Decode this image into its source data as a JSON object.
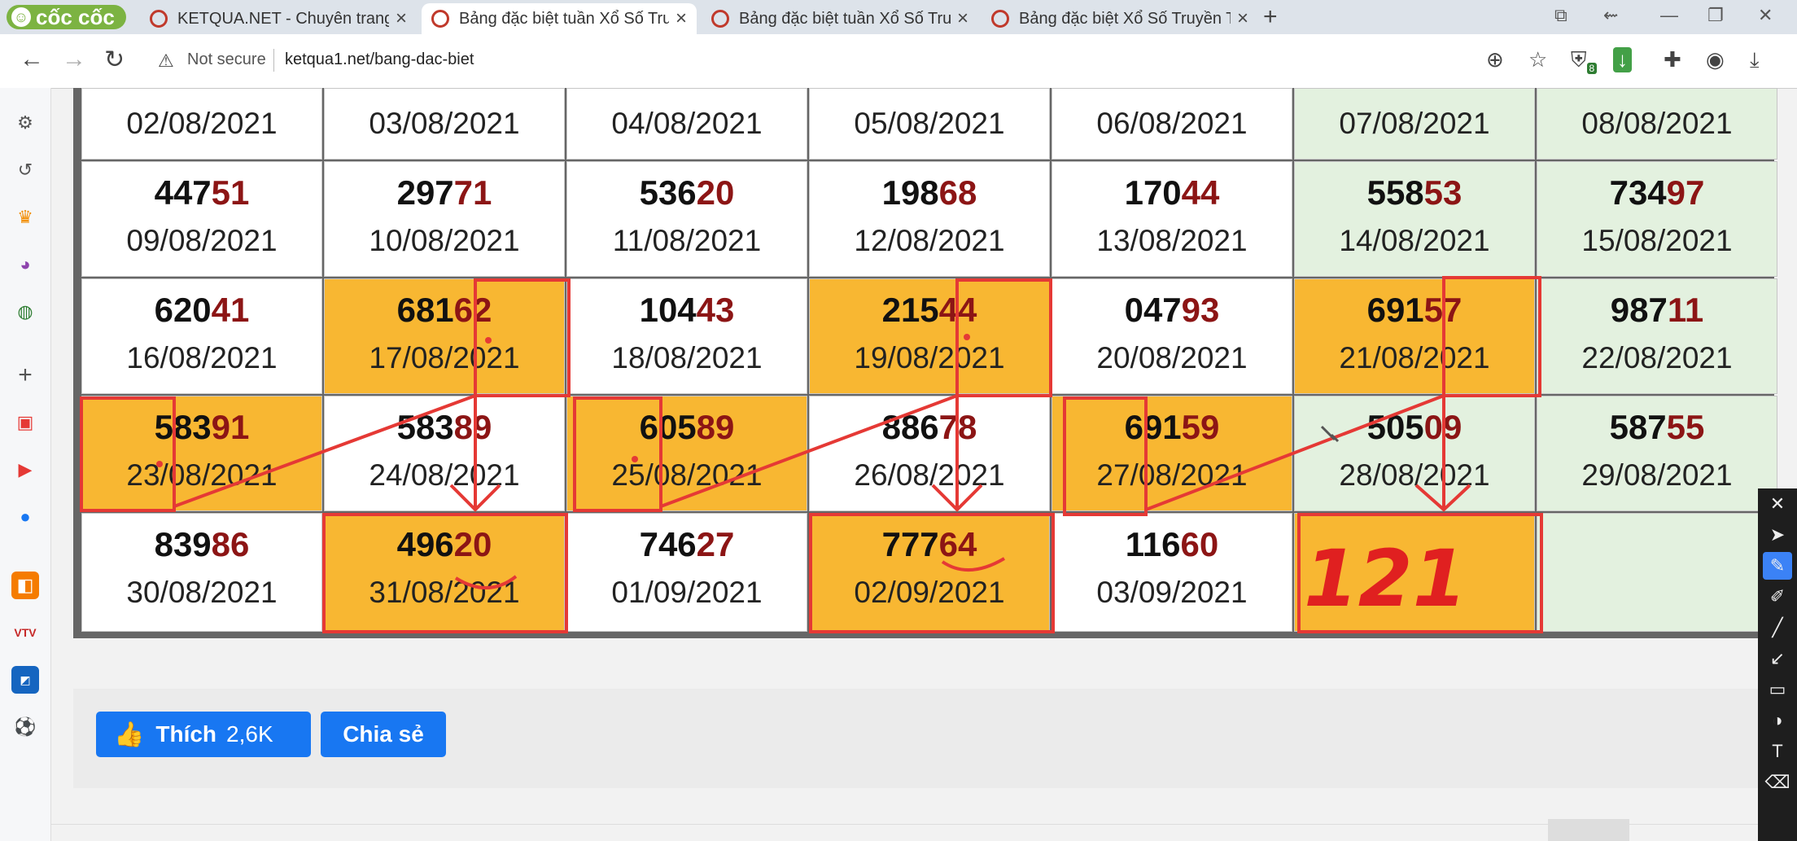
{
  "browser": {
    "brand": "cốc cốc",
    "tabs": [
      {
        "label": "KETQUA.NET - Chuyên trang"
      },
      {
        "label": "Bảng đặc biệt tuần Xổ Số Tru"
      },
      {
        "label": "Bảng đặc biệt tuần Xổ Số Tru"
      },
      {
        "label": "Bảng đặc biệt Xổ Số Truyền T"
      }
    ],
    "security": "Not secure",
    "url": "ketqua1.net/bang-dac-biet",
    "extension_badge": "8"
  },
  "table": {
    "rows": [
      {
        "cells": [
          {
            "head": "",
            "tail": "",
            "date": "02/08/2021",
            "bg": "white"
          },
          {
            "head": "",
            "tail": "",
            "date": "03/08/2021",
            "bg": "white"
          },
          {
            "head": "",
            "tail": "",
            "date": "04/08/2021",
            "bg": "white"
          },
          {
            "head": "",
            "tail": "",
            "date": "05/08/2021",
            "bg": "white"
          },
          {
            "head": "",
            "tail": "",
            "date": "06/08/2021",
            "bg": "white"
          },
          {
            "head": "",
            "tail": "",
            "date": "07/08/2021",
            "bg": "green"
          },
          {
            "head": "",
            "tail": "",
            "date": "08/08/2021",
            "bg": "green"
          }
        ]
      },
      {
        "cells": [
          {
            "head": "447",
            "tail": "51",
            "date": "09/08/2021",
            "bg": "white"
          },
          {
            "head": "297",
            "tail": "71",
            "date": "10/08/2021",
            "bg": "white"
          },
          {
            "head": "536",
            "tail": "20",
            "date": "11/08/2021",
            "bg": "white"
          },
          {
            "head": "198",
            "tail": "68",
            "date": "12/08/2021",
            "bg": "white"
          },
          {
            "head": "170",
            "tail": "44",
            "date": "13/08/2021",
            "bg": "white"
          },
          {
            "head": "558",
            "tail": "53",
            "date": "14/08/2021",
            "bg": "green"
          },
          {
            "head": "734",
            "tail": "97",
            "date": "15/08/2021",
            "bg": "green"
          }
        ]
      },
      {
        "cells": [
          {
            "head": "620",
            "tail": "41",
            "date": "16/08/2021",
            "bg": "white"
          },
          {
            "head": "681",
            "tail": "62",
            "date": "17/08/2021",
            "bg": "yellow"
          },
          {
            "head": "104",
            "tail": "43",
            "date": "18/08/2021",
            "bg": "white"
          },
          {
            "head": "215",
            "tail": "44",
            "date": "19/08/2021",
            "bg": "yellow"
          },
          {
            "head": "047",
            "tail": "93",
            "date": "20/08/2021",
            "bg": "white"
          },
          {
            "head": "691",
            "tail": "57",
            "date": "21/08/2021",
            "bg": "yellow"
          },
          {
            "head": "987",
            "tail": "11",
            "date": "22/08/2021",
            "bg": "green"
          }
        ]
      },
      {
        "cells": [
          {
            "head": "583",
            "tail": "91",
            "date": "23/08/2021",
            "bg": "yellow"
          },
          {
            "head": "583",
            "tail": "89",
            "date": "24/08/2021",
            "bg": "white"
          },
          {
            "head": "605",
            "tail": "89",
            "date": "25/08/2021",
            "bg": "yellow"
          },
          {
            "head": "886",
            "tail": "78",
            "date": "26/08/2021",
            "bg": "white"
          },
          {
            "head": "691",
            "tail": "59",
            "date": "27/08/2021",
            "bg": "yellow"
          },
          {
            "head": "505",
            "tail": "09",
            "date": "28/08/2021",
            "bg": "green"
          },
          {
            "head": "587",
            "tail": "55",
            "date": "29/08/2021",
            "bg": "green"
          }
        ]
      },
      {
        "cells": [
          {
            "head": "839",
            "tail": "86",
            "date": "30/08/2021",
            "bg": "white"
          },
          {
            "head": "496",
            "tail": "20",
            "date": "31/08/2021",
            "bg": "yellow"
          },
          {
            "head": "746",
            "tail": "27",
            "date": "01/09/2021",
            "bg": "white"
          },
          {
            "head": "777",
            "tail": "64",
            "date": "02/09/2021",
            "bg": "yellow"
          },
          {
            "head": "116",
            "tail": "60",
            "date": "03/09/2021",
            "bg": "white"
          },
          {
            "head": "",
            "tail": "",
            "date": "",
            "bg": "yellow"
          },
          {
            "head": "",
            "tail": "",
            "date": "",
            "bg": "green"
          }
        ]
      }
    ]
  },
  "annotation": {
    "handwritten": "121",
    "color": "#e02020"
  },
  "social": {
    "like_label": "Thích",
    "like_count": "2,6K",
    "share_label": "Chia sẻ"
  },
  "colors": {
    "accent_yellow": "#f8b732",
    "weekend_green": "#e3f1df",
    "tail_red": "#8c1515",
    "facebook_blue": "#1877f2"
  }
}
